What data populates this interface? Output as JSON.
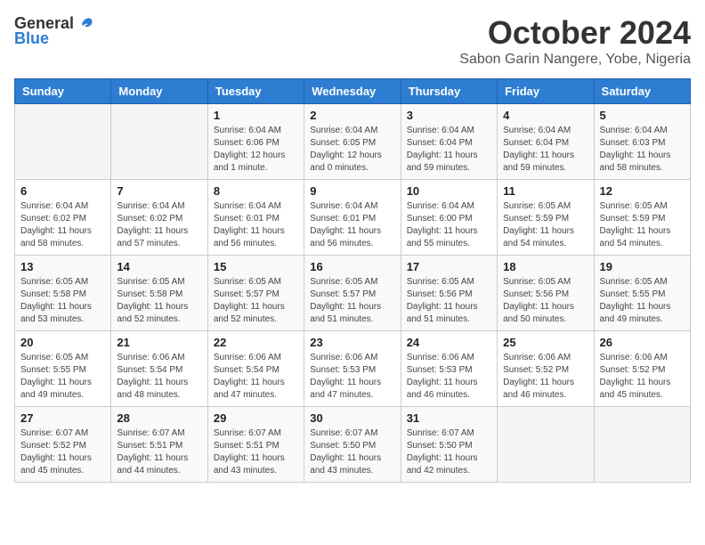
{
  "header": {
    "logo_general": "General",
    "logo_blue": "Blue",
    "month": "October 2024",
    "location": "Sabon Garin Nangere, Yobe, Nigeria"
  },
  "columns": [
    "Sunday",
    "Monday",
    "Tuesday",
    "Wednesday",
    "Thursday",
    "Friday",
    "Saturday"
  ],
  "weeks": [
    [
      {
        "day": "",
        "info": ""
      },
      {
        "day": "",
        "info": ""
      },
      {
        "day": "1",
        "info": "Sunrise: 6:04 AM\nSunset: 6:06 PM\nDaylight: 12 hours\nand 1 minute."
      },
      {
        "day": "2",
        "info": "Sunrise: 6:04 AM\nSunset: 6:05 PM\nDaylight: 12 hours\nand 0 minutes."
      },
      {
        "day": "3",
        "info": "Sunrise: 6:04 AM\nSunset: 6:04 PM\nDaylight: 11 hours\nand 59 minutes."
      },
      {
        "day": "4",
        "info": "Sunrise: 6:04 AM\nSunset: 6:04 PM\nDaylight: 11 hours\nand 59 minutes."
      },
      {
        "day": "5",
        "info": "Sunrise: 6:04 AM\nSunset: 6:03 PM\nDaylight: 11 hours\nand 58 minutes."
      }
    ],
    [
      {
        "day": "6",
        "info": "Sunrise: 6:04 AM\nSunset: 6:02 PM\nDaylight: 11 hours\nand 58 minutes."
      },
      {
        "day": "7",
        "info": "Sunrise: 6:04 AM\nSunset: 6:02 PM\nDaylight: 11 hours\nand 57 minutes."
      },
      {
        "day": "8",
        "info": "Sunrise: 6:04 AM\nSunset: 6:01 PM\nDaylight: 11 hours\nand 56 minutes."
      },
      {
        "day": "9",
        "info": "Sunrise: 6:04 AM\nSunset: 6:01 PM\nDaylight: 11 hours\nand 56 minutes."
      },
      {
        "day": "10",
        "info": "Sunrise: 6:04 AM\nSunset: 6:00 PM\nDaylight: 11 hours\nand 55 minutes."
      },
      {
        "day": "11",
        "info": "Sunrise: 6:05 AM\nSunset: 5:59 PM\nDaylight: 11 hours\nand 54 minutes."
      },
      {
        "day": "12",
        "info": "Sunrise: 6:05 AM\nSunset: 5:59 PM\nDaylight: 11 hours\nand 54 minutes."
      }
    ],
    [
      {
        "day": "13",
        "info": "Sunrise: 6:05 AM\nSunset: 5:58 PM\nDaylight: 11 hours\nand 53 minutes."
      },
      {
        "day": "14",
        "info": "Sunrise: 6:05 AM\nSunset: 5:58 PM\nDaylight: 11 hours\nand 52 minutes."
      },
      {
        "day": "15",
        "info": "Sunrise: 6:05 AM\nSunset: 5:57 PM\nDaylight: 11 hours\nand 52 minutes."
      },
      {
        "day": "16",
        "info": "Sunrise: 6:05 AM\nSunset: 5:57 PM\nDaylight: 11 hours\nand 51 minutes."
      },
      {
        "day": "17",
        "info": "Sunrise: 6:05 AM\nSunset: 5:56 PM\nDaylight: 11 hours\nand 51 minutes."
      },
      {
        "day": "18",
        "info": "Sunrise: 6:05 AM\nSunset: 5:56 PM\nDaylight: 11 hours\nand 50 minutes."
      },
      {
        "day": "19",
        "info": "Sunrise: 6:05 AM\nSunset: 5:55 PM\nDaylight: 11 hours\nand 49 minutes."
      }
    ],
    [
      {
        "day": "20",
        "info": "Sunrise: 6:05 AM\nSunset: 5:55 PM\nDaylight: 11 hours\nand 49 minutes."
      },
      {
        "day": "21",
        "info": "Sunrise: 6:06 AM\nSunset: 5:54 PM\nDaylight: 11 hours\nand 48 minutes."
      },
      {
        "day": "22",
        "info": "Sunrise: 6:06 AM\nSunset: 5:54 PM\nDaylight: 11 hours\nand 47 minutes."
      },
      {
        "day": "23",
        "info": "Sunrise: 6:06 AM\nSunset: 5:53 PM\nDaylight: 11 hours\nand 47 minutes."
      },
      {
        "day": "24",
        "info": "Sunrise: 6:06 AM\nSunset: 5:53 PM\nDaylight: 11 hours\nand 46 minutes."
      },
      {
        "day": "25",
        "info": "Sunrise: 6:06 AM\nSunset: 5:52 PM\nDaylight: 11 hours\nand 46 minutes."
      },
      {
        "day": "26",
        "info": "Sunrise: 6:06 AM\nSunset: 5:52 PM\nDaylight: 11 hours\nand 45 minutes."
      }
    ],
    [
      {
        "day": "27",
        "info": "Sunrise: 6:07 AM\nSunset: 5:52 PM\nDaylight: 11 hours\nand 45 minutes."
      },
      {
        "day": "28",
        "info": "Sunrise: 6:07 AM\nSunset: 5:51 PM\nDaylight: 11 hours\nand 44 minutes."
      },
      {
        "day": "29",
        "info": "Sunrise: 6:07 AM\nSunset: 5:51 PM\nDaylight: 11 hours\nand 43 minutes."
      },
      {
        "day": "30",
        "info": "Sunrise: 6:07 AM\nSunset: 5:50 PM\nDaylight: 11 hours\nand 43 minutes."
      },
      {
        "day": "31",
        "info": "Sunrise: 6:07 AM\nSunset: 5:50 PM\nDaylight: 11 hours\nand 42 minutes."
      },
      {
        "day": "",
        "info": ""
      },
      {
        "day": "",
        "info": ""
      }
    ]
  ]
}
